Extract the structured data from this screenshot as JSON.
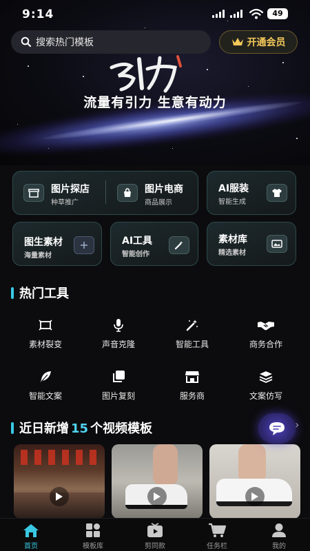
{
  "status": {
    "time": "9:14",
    "battery": "49"
  },
  "search": {
    "placeholder": "搜索热门模板"
  },
  "vip": {
    "label": "开通会员"
  },
  "hero": {
    "logo_text": "引力",
    "slogan": "流量有引力 生意有动力"
  },
  "features": {
    "store_visit": {
      "title": "图片探店",
      "sub": "种草推广"
    },
    "ecommerce": {
      "title": "图片电商",
      "sub": "商品展示"
    },
    "ai_clothing": {
      "title": "AI服装",
      "sub": "智能生成"
    },
    "image_material": {
      "title": "图生素材",
      "sub": "海量素材"
    },
    "ai_tools": {
      "title": "AI工具",
      "sub": "智能创作"
    },
    "material_lib": {
      "title": "素材库",
      "sub": "精选素材"
    }
  },
  "hot_tools": {
    "heading": "热门工具",
    "items": [
      {
        "label": "素材裂变",
        "icon": "frame-icon"
      },
      {
        "label": "声音克隆",
        "icon": "microphone-icon"
      },
      {
        "label": "智能工具",
        "icon": "magic-wand-icon"
      },
      {
        "label": "商务合作",
        "icon": "handshake-icon"
      },
      {
        "label": "智能文案",
        "icon": "feather-icon"
      },
      {
        "label": "图片复刻",
        "icon": "copy-image-icon"
      },
      {
        "label": "服务商",
        "icon": "store-icon"
      },
      {
        "label": "文案仿写",
        "icon": "layers-icon"
      }
    ]
  },
  "new_templates": {
    "prefix": "近日新增",
    "count": "15",
    "suffix": "个视频模板"
  },
  "tabs": [
    {
      "label": "首页",
      "icon": "home-icon",
      "active": true
    },
    {
      "label": "模板库",
      "icon": "grid-icon",
      "active": false
    },
    {
      "label": "剪同款",
      "icon": "video-icon",
      "active": false
    },
    {
      "label": "任务栏",
      "icon": "cart-icon",
      "active": false
    },
    {
      "label": "我的",
      "icon": "user-icon",
      "active": false
    }
  ],
  "colors": {
    "accent": "#39c8e3",
    "gold": "#f3c95a",
    "card_border": "#2e4a4c",
    "fab": "#4c3fb8"
  }
}
